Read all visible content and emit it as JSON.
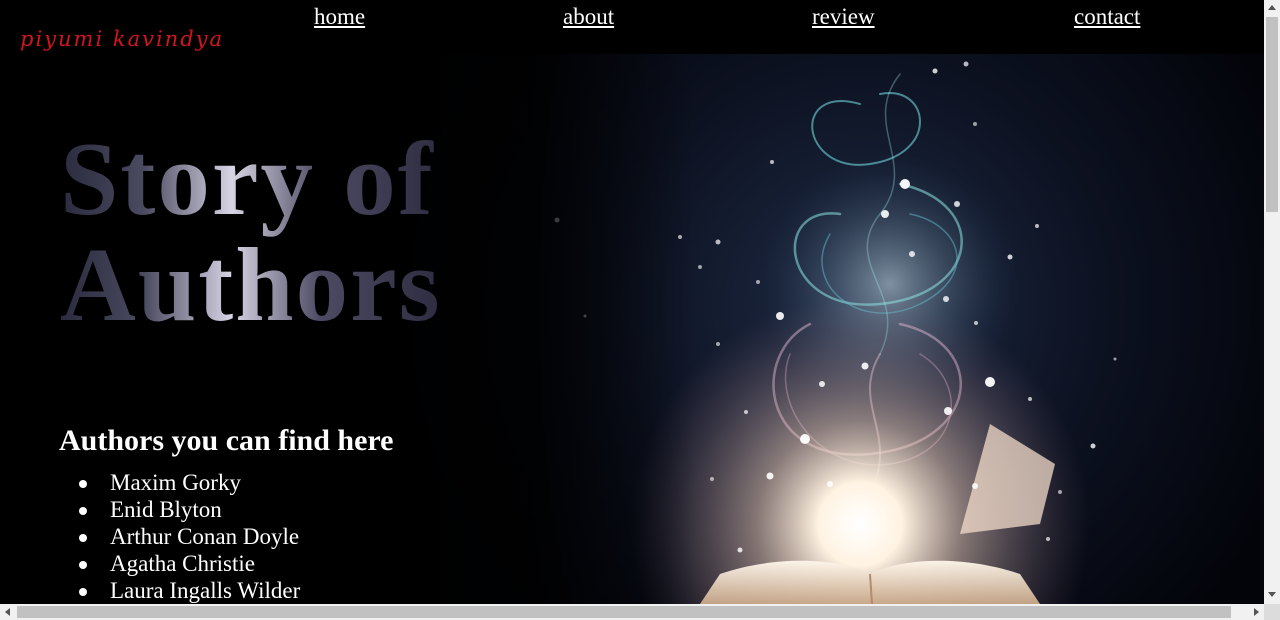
{
  "logo": {
    "text": "piyumi kavindya",
    "color": "#d2141e"
  },
  "nav": {
    "items": [
      {
        "label": "home"
      },
      {
        "label": "about"
      },
      {
        "label": "review"
      },
      {
        "label": "contact"
      }
    ]
  },
  "hero": {
    "title_line1": "Story of",
    "title_line2": "Authors",
    "image": "magic-book-image"
  },
  "authors_section": {
    "heading": "Authors you can find here",
    "authors": [
      "Maxim Gorky",
      "Enid Blyton",
      "Arthur Conan Doyle",
      "Agatha Christie",
      "Laura Ingalls Wilder"
    ]
  },
  "colors": {
    "background": "#000000",
    "text": "#ffffff"
  }
}
